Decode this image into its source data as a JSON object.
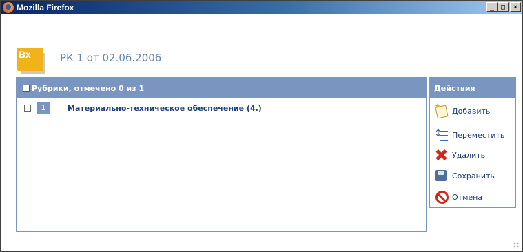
{
  "window": {
    "title": "Mozilla Firefox"
  },
  "document": {
    "badge": "Вх",
    "title": "РК 1 от 02.06.2006"
  },
  "rubrics": {
    "header": "Рубрики, отмечено 0 из 1",
    "items": [
      {
        "number": "1",
        "label": "Материально-техническое обеспечение (4.)"
      }
    ]
  },
  "actions": {
    "header": "Действия",
    "items": [
      {
        "label": "Добавить",
        "icon": "add-icon"
      },
      {
        "label": "Переместить",
        "icon": "move-icon"
      },
      {
        "label": "Удалить",
        "icon": "delete-icon"
      },
      {
        "label": "Сохранить",
        "icon": "save-icon"
      },
      {
        "label": "Отмена",
        "icon": "cancel-icon"
      }
    ]
  }
}
